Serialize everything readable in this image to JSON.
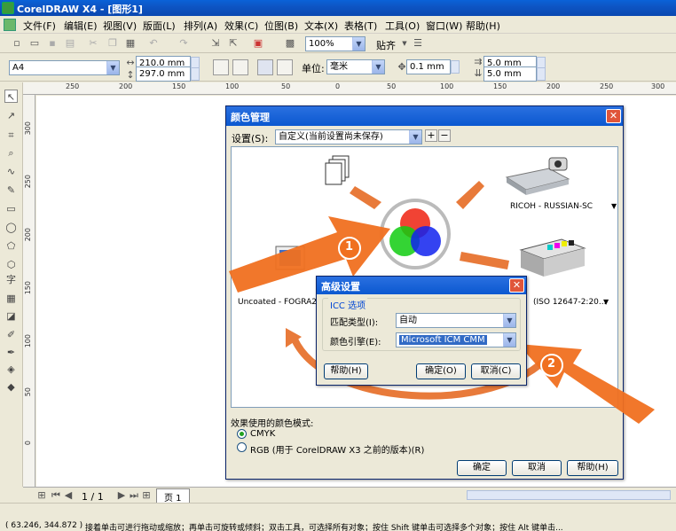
{
  "window": {
    "title": "CorelDRAW X4 - [图形1]"
  },
  "menu": [
    "文件(F)",
    "编辑(E)",
    "视图(V)",
    "版面(L)",
    "排列(A)",
    "效果(C)",
    "位图(B)",
    "文本(X)",
    "表格(T)",
    "工具(O)",
    "窗口(W)",
    "帮助(H)"
  ],
  "toolbar": {
    "zoom": "100%",
    "snap": "贴齐"
  },
  "propbar": {
    "paper": "A4",
    "width": "210.0 mm",
    "height": "297.0 mm",
    "units_label": "单位:",
    "units": "毫米",
    "nudge": "0.1 mm",
    "dup_x": "5.0 mm",
    "dup_y": "5.0 mm"
  },
  "ruler_h": [
    "250",
    "200",
    "150",
    "100",
    "50",
    "0",
    "50",
    "100",
    "150",
    "200",
    "250",
    "300"
  ],
  "ruler_v": [
    "300",
    "250",
    "200",
    "150",
    "100",
    "50",
    "0"
  ],
  "color_dialog": {
    "title": "颜色管理",
    "settings_label": "设置(S):",
    "settings_value": "自定义(当前设置尚未保存)",
    "device_scanner": "RICOH - RUSSIAN-SC",
    "device_left": "Uncoated - FOGRA29 (I",
    "device_printer": "(ISO 12647-2:20...",
    "mode_label": "效果使用的颜色模式:",
    "mode_cmyk": "CMYK",
    "mode_rgb": "RGB (用于 CorelDRAW X3 之前的版本)(R)",
    "ok": "确定",
    "cancel": "取消",
    "help": "帮助(H)"
  },
  "advanced_dialog": {
    "title": "高级设置",
    "group": "ICC 选项",
    "match_label": "匹配类型(I):",
    "match_value": "自动",
    "engine_label": "颜色引擎(E):",
    "engine_value": "Microsoft ICM CMM",
    "help": "帮助(H)",
    "ok": "确定(O)",
    "cancel": "取消(C)"
  },
  "callouts": [
    "1",
    "2"
  ],
  "pagebar": {
    "page_count": "1 / 1",
    "page_tab": "页 1"
  },
  "status": {
    "coords": "( 63.246, 344.872 )",
    "message": "接着单击可进行拖动或缩放；再单击可旋转或倾斜；双击工具，可选择所有对象；按住 Shift 键单击可选择多个对象；按住 Alt 键单击..."
  },
  "colors": {
    "title_blue": "#0b58d0",
    "highlight_orange": "#f07020"
  }
}
